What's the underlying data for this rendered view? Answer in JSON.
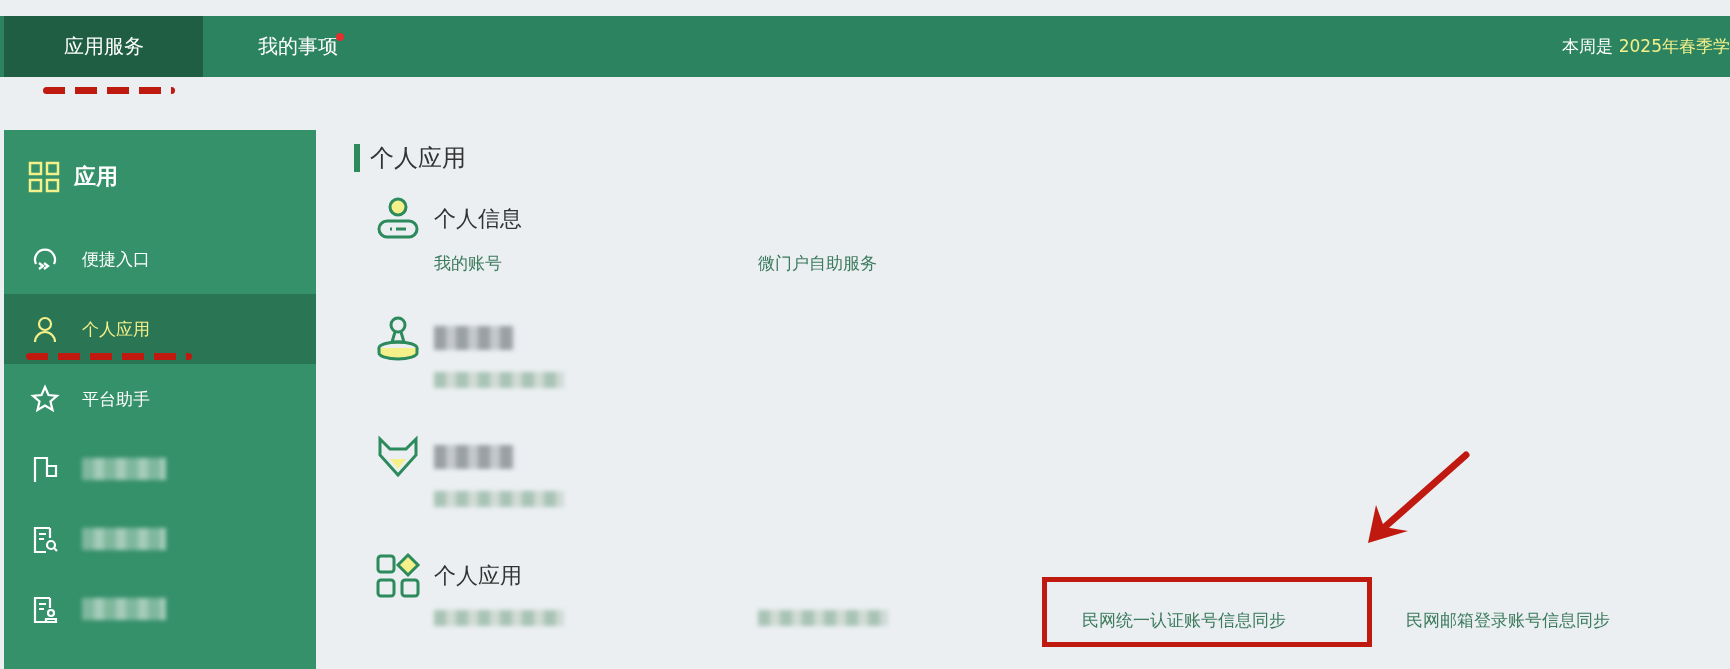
{
  "top_nav": {
    "tabs": [
      {
        "label": "应用服务",
        "selected": true,
        "dot": false
      },
      {
        "label": "我的事项",
        "selected": false,
        "dot": true
      }
    ],
    "notice": {
      "prefix": "本周是",
      "highlight": "2025年春季学"
    }
  },
  "sidebar": {
    "title": "应用",
    "items": [
      {
        "label": "便捷入口",
        "selected": false,
        "kind": "text"
      },
      {
        "label": "个人应用",
        "selected": true,
        "kind": "text"
      },
      {
        "label": "平台助手",
        "selected": false,
        "kind": "text"
      },
      {
        "kind": "blurred",
        "selected": false
      },
      {
        "kind": "blurred",
        "selected": false
      },
      {
        "kind": "blurred",
        "selected": false
      }
    ]
  },
  "content": {
    "heading": "个人应用",
    "groups": [
      {
        "title": {
          "kind": "text",
          "text": "个人信息"
        },
        "links": [
          {
            "kind": "text",
            "text": "我的账号"
          },
          {
            "kind": "text",
            "text": "微门户自助服务"
          }
        ]
      },
      {
        "title": {
          "kind": "blurred"
        },
        "links": [
          {
            "kind": "blurred"
          }
        ]
      },
      {
        "title": {
          "kind": "blurred"
        },
        "links": [
          {
            "kind": "blurred"
          }
        ]
      },
      {
        "title": {
          "kind": "text",
          "text": "个人应用"
        },
        "links": [
          {
            "kind": "blurred"
          },
          {
            "kind": "blurred"
          },
          {
            "kind": "text",
            "text": "民网统一认证账号信息同步",
            "highlighted": true
          },
          {
            "kind": "text",
            "text": "民网邮箱登录账号信息同步"
          }
        ]
      }
    ]
  }
}
